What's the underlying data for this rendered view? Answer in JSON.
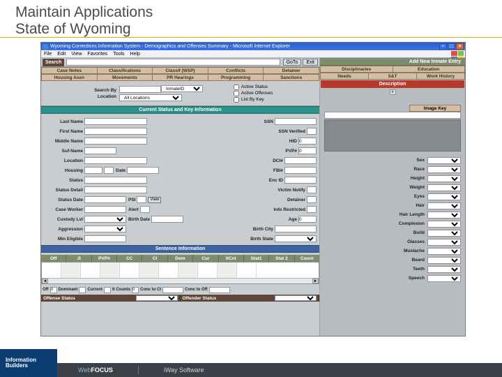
{
  "slide": {
    "line1": "Maintain Applications",
    "line2": "State of Wyoming"
  },
  "window": {
    "title": "Wyoming Corrections Information System - Demographics and Offenses Summary - Microsoft Internet Explorer",
    "menu": [
      "File",
      "Edit",
      "View",
      "Favorites",
      "Tools",
      "Help"
    ]
  },
  "toolbar": {
    "search_label": "Search",
    "search_value": "",
    "goto_btn": "GoTo",
    "exit_btn": "Exit",
    "add_row": "Add New Inmate Entry"
  },
  "tabs_left_row1": [
    "Case Notes",
    "Classifications",
    "Classif (WSP)",
    "Conflicts",
    "Detainer"
  ],
  "tabs_left_row2": [
    "Housing Assn",
    "Movements",
    "PR Hearings",
    "Programming",
    "Sanctions"
  ],
  "tabs_right_row1": [
    "Disciplinaries",
    "Education"
  ],
  "tabs_right_row2": [
    "Needs",
    "S&T",
    "Work History"
  ],
  "filter": {
    "search_by_label": "Search By",
    "search_by_value": "InmateID",
    "location_label": "Location",
    "location_value": "All Locations",
    "chk_active_status": "Active Status",
    "chk_active_offenses": "Active Offenses",
    "chk_list_by_key": "List By Key"
  },
  "sections": {
    "current_status": "Current Status and Key Information",
    "sentence_info": "Sentence Information",
    "description": "Description"
  },
  "fields": {
    "last_name": "Last Name",
    "ssn": "SSN",
    "first_name": "First Name",
    "ssn_verified": "SSN Verified",
    "middle_name": "Middle Name",
    "hid": "HID",
    "id_val": "0",
    "suffix": "Suf-Name",
    "pvp": "PVP#",
    "pvp_val": "0",
    "location": "Location",
    "dci": "DCI#",
    "housing": "Housing",
    "date": "Date",
    "fbi": "FBI#",
    "status": "Status",
    "encid": "Enc ID",
    "status_detail": "Status Detail",
    "victim_notify": "Victim Notify",
    "status_date": "Status Date",
    "psi": "PSI",
    "view_btn": "View",
    "detainer": "Detainer",
    "case_worker": "Case Worker",
    "alert": "Alert",
    "info_restricted": "Info Restricted",
    "custody_lvl": "Custody Lvl",
    "birth_date": "Birth Date",
    "age": "Age",
    "age_val": "0",
    "aggression": "Aggression",
    "birth_city": "Birth City",
    "min_eligible": "Min Eligible",
    "birth_state": "Birth State",
    "image_key": "Image Key"
  },
  "sent_grid_cols": [
    "Off",
    "JI",
    "PVP#",
    "CC",
    "CI",
    "Dom",
    "Cur",
    "ItCnt",
    "Stat1",
    "Stat 2",
    "Count"
  ],
  "foot": {
    "off": "Off",
    "off_val": "0",
    "dominant": "Dominant",
    "current": "Current",
    "itcounts": "It Counts",
    "itcounts_val": "0",
    "conc_ci": "Conc to CI",
    "conc_off": "Conc to Off"
  },
  "status_row": {
    "offense_status": "Offense Status",
    "offender_status": "Offender Status"
  },
  "traits": [
    "Sex",
    "Race",
    "Height",
    "Weight",
    "Eyes",
    "Hair",
    "Hair Length",
    "Complexion",
    "Build",
    "Glasses",
    "Mustache",
    "Beard",
    "Teeth",
    "Speech"
  ],
  "vendors": {
    "ib1": "Information",
    "ib2": "Builders",
    "wf": "WebFOCUS",
    "iway": "iWay Software"
  }
}
